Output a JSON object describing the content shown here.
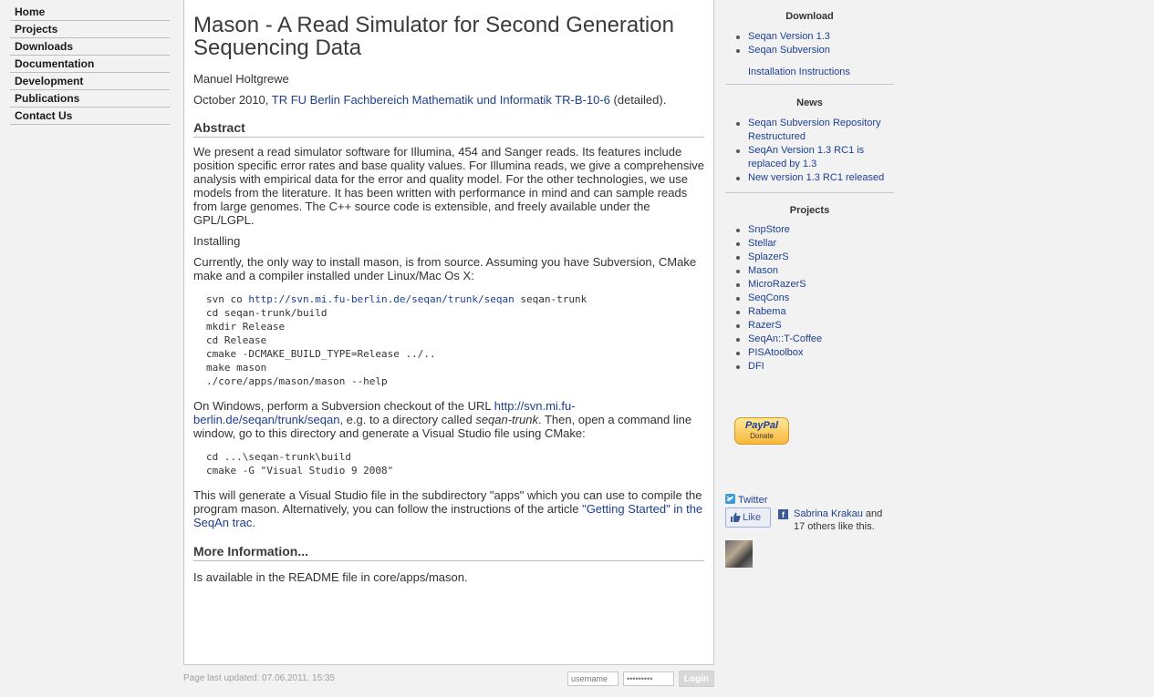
{
  "nav": [
    "Home",
    "Projects",
    "Downloads",
    "Documentation",
    "Development",
    "Publications",
    "Contact Us"
  ],
  "article": {
    "title": "Mason - A Read Simulator for Second Generation Sequencing Data",
    "author": "Manuel Holtgrewe",
    "pub_date": "October 2010,",
    "pub_link": "TR FU Berlin Fachbereich Mathematik und Informatik TR-B-10-6",
    "pub_suffix": "(detailed).",
    "abstract_heading": "Abstract",
    "abstract_text": "We present a read simulator software for Illumina, 454 and Sanger reads. Its features include position specific error rates and base quality values. For Illumina reads, we give a comprehensive analysis with empirical data for the error and quality model. For the other technologies, we use models from the literature. It has been written with performance in mind and can sample reads from large genomes. The C++ source code is extensible, and freely available under the GPL/LGPL.",
    "installing_label": "Installing",
    "install_intro": "Currently, the only way to install mason, is from source. Assuming you have Subversion, CMake make and a compiler installed under Linux/Mac Os X:",
    "code1_prefix": "svn co ",
    "code1_link": "http://svn.mi.fu-berlin.de/seqan/trunk/seqan",
    "code1_suffix": " seqan-trunk",
    "code1_rest": "cd seqan-trunk/build\nmkdir Release\ncd Release\ncmake -DCMAKE_BUILD_TYPE=Release ../..\nmake mason\n./core/apps/mason/mason --help",
    "windows_prefix": "On Windows, perform a Subversion checkout of the URL ",
    "windows_link": "http://svn.mi.fu-berlin.de/seqan/trunk/seqan",
    "windows_mid": ", e.g. to a directory called ",
    "windows_dir": "seqan-trunk",
    "windows_suffix": ". Then, open a command line window, go to this directory and generate a Visual Studio file using CMake:",
    "code2": "cd ...\\seqan-trunk\\build\ncmake -G \"Visual Studio 9 2008\"",
    "vs_prefix": "This will generate a Visual Studio file in the subdirectory \"apps\" which you can use to compile the program mason. Alternatively, you can follow the instructions of the article ",
    "vs_link": "\"Getting Started\" in the SeqAn trac",
    "vs_suffix": ".",
    "more_heading": "More Information...",
    "more_text": "Is available in the README file in core/apps/mason."
  },
  "footer": {
    "updated": "Page last updated: 07.06.2011, 15:35",
    "username_placeholder": "username",
    "password_placeholder": "•••••••••",
    "login_label": "Login"
  },
  "sidebar": {
    "download_heading": "Download",
    "downloads": [
      "Seqan Version 1.3",
      "Seqan Subversion"
    ],
    "install_link": "Installation Instructions",
    "news_heading": "News",
    "news": [
      "Seqan Subversion Repository Restructured",
      "SeqAn Version 1.3 RC1 is replaced by 1.3",
      "New version 1.3 RC1 released"
    ],
    "projects_heading": "Projects",
    "projects": [
      "SnpStore",
      "Stellar",
      "SplazerS",
      "Mason",
      "MicroRazerS",
      "SeqCons",
      "Rabema",
      "RazerS",
      "SeqAn::T-Coffee",
      "PISAtoolbox",
      "DFI"
    ],
    "paypal_logo": "PayPal",
    "paypal_donate": "Donate",
    "twitter_label": "Twitter",
    "like_label": "Like",
    "fb_letter": "f",
    "fb_name": "Sabrina Krakau",
    "fb_text_mid": " and",
    "fb_text_rest": "17 others like this."
  }
}
